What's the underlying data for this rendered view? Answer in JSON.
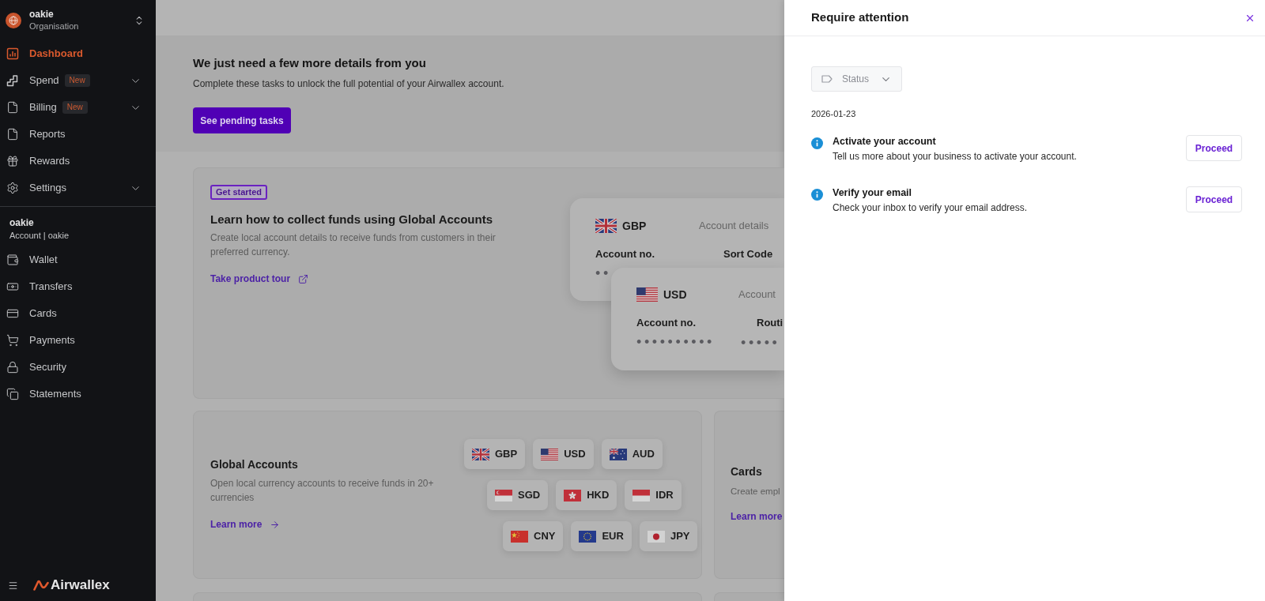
{
  "sidebar": {
    "org": {
      "name": "oakie",
      "subtitle": "Organisation"
    },
    "main_nav": [
      {
        "label": "Dashboard",
        "selected": true,
        "collapsible": false
      },
      {
        "label": "Spend",
        "selected": false,
        "badge": "New",
        "collapsible": true
      },
      {
        "label": "Billing",
        "selected": false,
        "badge": "New",
        "collapsible": true
      },
      {
        "label": "Reports",
        "selected": false,
        "collapsible": false
      },
      {
        "label": "Rewards",
        "selected": false,
        "collapsible": false
      },
      {
        "label": "Settings",
        "selected": false,
        "collapsible": true
      }
    ],
    "account": {
      "name": "oakie",
      "subtitle": "Account | oakie"
    },
    "account_nav": [
      {
        "label": "Wallet",
        "selected": false,
        "collapsible": false
      },
      {
        "label": "Transfers",
        "selected": false,
        "collapsible": false
      },
      {
        "label": "Cards",
        "selected": false,
        "collapsible": false
      },
      {
        "label": "Payments",
        "selected": false,
        "collapsible": false
      },
      {
        "label": "Security",
        "selected": false,
        "collapsible": false
      },
      {
        "label": "Statements",
        "selected": false,
        "collapsible": false
      }
    ],
    "brand": "Airwallex"
  },
  "banner": {
    "title": "We just need a few more details from you",
    "text": "Complete these tasks to unlock the full potential of your Airwallex account.",
    "button": "See pending tasks"
  },
  "tour_card": {
    "badge": "Get started",
    "title": "Learn how to collect funds using Global Accounts",
    "text": "Create local account details to receive funds from customers in their preferred currency.",
    "link": "Take product tour",
    "details_cards": [
      {
        "kind": "uk",
        "currency": "GBP",
        "heading": "Account details",
        "fields": [
          {
            "label": "Account no.",
            "value": "••"
          },
          {
            "label": "Sort Code"
          }
        ]
      },
      {
        "kind": "us",
        "currency": "USD",
        "heading": "Account",
        "fields": [
          {
            "label": "Account no.",
            "value": "••••••••••"
          },
          {
            "label": "Routi",
            "value": "•••••"
          }
        ]
      }
    ]
  },
  "global_accounts_card": {
    "title": "Global Accounts",
    "text": "Open local currency accounts to receive funds in 20+ currencies",
    "link": "Learn more",
    "currency_rows": [
      [
        {
          "kind": "uk",
          "code": "GBP"
        },
        {
          "kind": "us",
          "code": "USD"
        },
        {
          "kind": "au",
          "code": "AUD"
        }
      ],
      [
        {
          "kind": "sg",
          "code": "SGD"
        },
        {
          "kind": "hk",
          "code": "HKD"
        },
        {
          "kind": "id",
          "code": "IDR"
        }
      ],
      [
        {
          "kind": "cn",
          "code": "CNY"
        },
        {
          "kind": "eu",
          "code": "EUR"
        },
        {
          "kind": "jp",
          "code": "JPY"
        }
      ]
    ]
  },
  "cards_card": {
    "title": "Cards",
    "text": "Create empl",
    "link": "Learn more"
  },
  "panel": {
    "title": "Require attention",
    "filter": "Status",
    "date": "2026-01-23",
    "tasks": [
      {
        "title": "Activate your account",
        "description": "Tell us more about your business to activate your account.",
        "action": "Proceed"
      },
      {
        "title": "Verify your email",
        "description": "Check your inbox to verify your email address.",
        "action": "Proceed"
      }
    ]
  }
}
